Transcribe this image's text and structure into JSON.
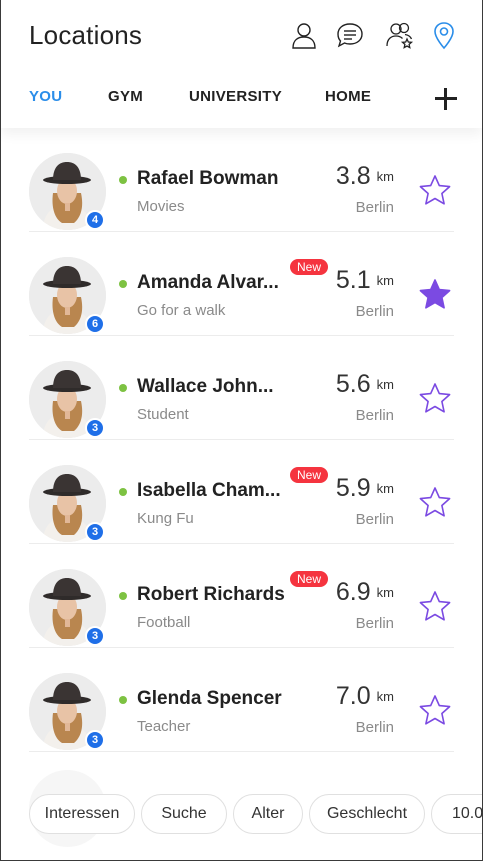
{
  "header": {
    "title": "Locations",
    "icons": [
      "person-icon",
      "chat-icon",
      "people-star-icon",
      "location-pin-icon"
    ]
  },
  "tabs": [
    {
      "label": "YOU",
      "active": true
    },
    {
      "label": "GYM",
      "active": false
    },
    {
      "label": "UNIVERSITY",
      "active": false
    },
    {
      "label": "HOME",
      "active": false
    }
  ],
  "people": [
    {
      "name": "Rafael Bowman",
      "subtitle": "Movies",
      "distance": "3.8",
      "unit": "km",
      "city": "Berlin",
      "badge": "4",
      "is_new": false,
      "starred": false
    },
    {
      "name": "Amanda Alvar...",
      "subtitle": "Go for a walk",
      "distance": "5.1",
      "unit": "km",
      "city": "Berlin",
      "badge": "6",
      "is_new": true,
      "starred": true
    },
    {
      "name": "Wallace John...",
      "subtitle": "Student",
      "distance": "5.6",
      "unit": "km",
      "city": "Berlin",
      "badge": "3",
      "is_new": false,
      "starred": false
    },
    {
      "name": "Isabella Cham...",
      "subtitle": "Kung Fu",
      "distance": "5.9",
      "unit": "km",
      "city": "Berlin",
      "badge": "3",
      "is_new": true,
      "starred": false
    },
    {
      "name": "Robert Richards",
      "subtitle": "Football",
      "distance": "6.9",
      "unit": "km",
      "city": "Berlin",
      "badge": "3",
      "is_new": true,
      "starred": false
    },
    {
      "name": "Glenda Spencer",
      "subtitle": "Teacher",
      "distance": "7.0",
      "unit": "km",
      "city": "Berlin",
      "badge": "3",
      "is_new": false,
      "starred": false
    }
  ],
  "new_label": "New",
  "filters": [
    "Interessen",
    "Suche",
    "Alter",
    "Geschlecht",
    "10.0"
  ],
  "colors": {
    "accent": "#2a8de9",
    "star": "#7b4ae2",
    "badge": "#1f6fe8",
    "new_tag": "#f5343f",
    "online": "#7dc242"
  }
}
